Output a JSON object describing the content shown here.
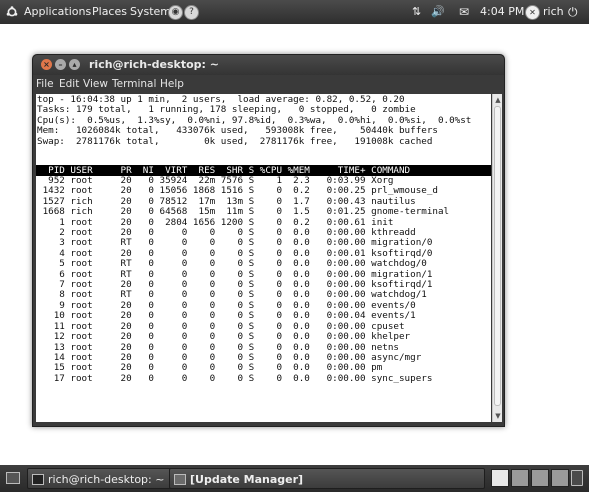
{
  "top_panel": {
    "menus": [
      "Applications",
      "Places",
      "System"
    ],
    "clock": "4:04 PM",
    "user": "rich"
  },
  "terminal": {
    "title": "rich@rich-desktop: ~",
    "menu": [
      "File",
      "Edit",
      "View",
      "Terminal",
      "Help"
    ],
    "summary_lines": [
      "top - 16:04:38 up 1 min,  2 users,  load average: 0.82, 0.52, 0.20",
      "Tasks: 179 total,   1 running, 178 sleeping,   0 stopped,   0 zombie",
      "Cpu(s):  0.5%us,  1.3%sy,  0.0%ni, 97.8%id,  0.3%wa,  0.0%hi,  0.0%si,  0.0%st",
      "Mem:   1026084k total,   433076k used,   593008k free,    50440k buffers",
      "Swap:  2781176k total,        0k used,  2781176k free,   191008k cached"
    ],
    "columns": [
      "PID",
      "USER",
      "PR",
      "NI",
      "VIRT",
      "RES",
      "SHR",
      "S",
      "%CPU",
      "%MEM",
      "TIME+",
      "COMMAND"
    ],
    "processes": [
      [
        "952",
        "root",
        "20",
        "0",
        "35924",
        "22m",
        "7576",
        "S",
        "1",
        "2.3",
        "0:03.99",
        "Xorg"
      ],
      [
        "1432",
        "root",
        "20",
        "0",
        "15056",
        "1868",
        "1516",
        "S",
        "0",
        "0.2",
        "0:00.25",
        "prl_wmouse_d"
      ],
      [
        "1527",
        "rich",
        "20",
        "0",
        "78512",
        "17m",
        "13m",
        "S",
        "0",
        "1.7",
        "0:00.43",
        "nautilus"
      ],
      [
        "1668",
        "rich",
        "20",
        "0",
        "64568",
        "15m",
        "11m",
        "S",
        "0",
        "1.5",
        "0:01.25",
        "gnome-terminal"
      ],
      [
        "1",
        "root",
        "20",
        "0",
        "2804",
        "1656",
        "1200",
        "S",
        "0",
        "0.2",
        "0:00.61",
        "init"
      ],
      [
        "2",
        "root",
        "20",
        "0",
        "0",
        "0",
        "0",
        "S",
        "0",
        "0.0",
        "0:00.00",
        "kthreadd"
      ],
      [
        "3",
        "root",
        "RT",
        "0",
        "0",
        "0",
        "0",
        "S",
        "0",
        "0.0",
        "0:00.00",
        "migration/0"
      ],
      [
        "4",
        "root",
        "20",
        "0",
        "0",
        "0",
        "0",
        "S",
        "0",
        "0.0",
        "0:00.01",
        "ksoftirqd/0"
      ],
      [
        "5",
        "root",
        "RT",
        "0",
        "0",
        "0",
        "0",
        "S",
        "0",
        "0.0",
        "0:00.00",
        "watchdog/0"
      ],
      [
        "6",
        "root",
        "RT",
        "0",
        "0",
        "0",
        "0",
        "S",
        "0",
        "0.0",
        "0:00.00",
        "migration/1"
      ],
      [
        "7",
        "root",
        "20",
        "0",
        "0",
        "0",
        "0",
        "S",
        "0",
        "0.0",
        "0:00.00",
        "ksoftirqd/1"
      ],
      [
        "8",
        "root",
        "RT",
        "0",
        "0",
        "0",
        "0",
        "S",
        "0",
        "0.0",
        "0:00.00",
        "watchdog/1"
      ],
      [
        "9",
        "root",
        "20",
        "0",
        "0",
        "0",
        "0",
        "S",
        "0",
        "0.0",
        "0:00.00",
        "events/0"
      ],
      [
        "10",
        "root",
        "20",
        "0",
        "0",
        "0",
        "0",
        "S",
        "0",
        "0.0",
        "0:00.04",
        "events/1"
      ],
      [
        "11",
        "root",
        "20",
        "0",
        "0",
        "0",
        "0",
        "S",
        "0",
        "0.0",
        "0:00.00",
        "cpuset"
      ],
      [
        "12",
        "root",
        "20",
        "0",
        "0",
        "0",
        "0",
        "S",
        "0",
        "0.0",
        "0:00.00",
        "khelper"
      ],
      [
        "13",
        "root",
        "20",
        "0",
        "0",
        "0",
        "0",
        "S",
        "0",
        "0.0",
        "0:00.00",
        "netns"
      ],
      [
        "14",
        "root",
        "20",
        "0",
        "0",
        "0",
        "0",
        "S",
        "0",
        "0.0",
        "0:00.00",
        "async/mgr"
      ],
      [
        "15",
        "root",
        "20",
        "0",
        "0",
        "0",
        "0",
        "S",
        "0",
        "0.0",
        "0:00.00",
        "pm"
      ],
      [
        "17",
        "root",
        "20",
        "0",
        "0",
        "0",
        "0",
        "S",
        "0",
        "0.0",
        "0:00.00",
        "sync_supers"
      ]
    ]
  },
  "taskbar": {
    "items": [
      "rich@rich-desktop: ~",
      "[Update Manager]"
    ]
  },
  "icons": {
    "logo": "ubuntu-logo-icon",
    "menu_extra": [
      "globe-icon",
      "help-icon"
    ],
    "tray": [
      "network-arrows-icon",
      "volume-icon",
      "mail-icon",
      "user-status-icon",
      "power-icon"
    ],
    "window_buttons": [
      "close-icon",
      "minimize-icon",
      "maximize-icon"
    ],
    "bottom_left": "show-desktop-icon",
    "bottom_right": [
      "workspace-switcher-icon",
      "trash-icon"
    ]
  },
  "colors": {
    "panel": "#3a3a3a",
    "close_button": "#e0764a",
    "window_button": "#a9a9a9",
    "terminal_bg": "#ffffff",
    "terminal_fg": "#111111",
    "header_bg": "#000000"
  }
}
